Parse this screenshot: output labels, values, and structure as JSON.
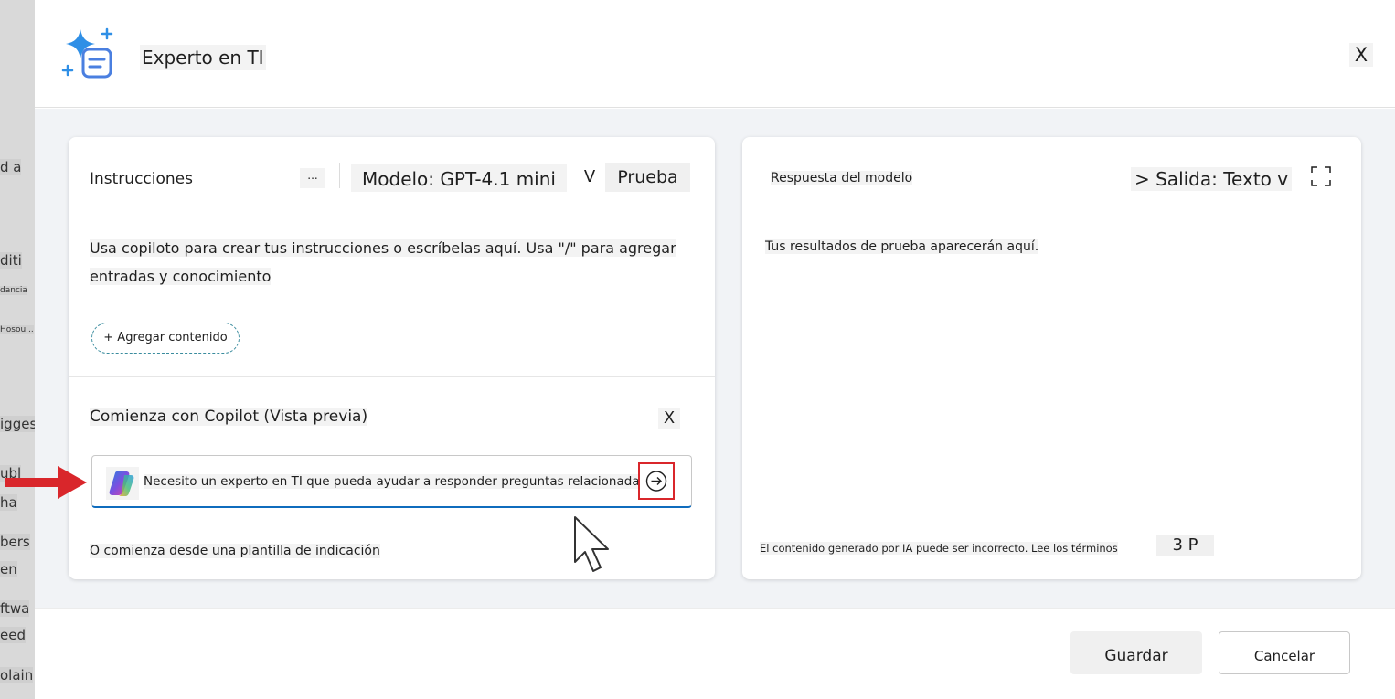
{
  "background": {
    "fragments": [
      "d a",
      "diti",
      "dancia",
      "Hosou...",
      "igges",
      "ubl",
      "ha",
      "bers",
      "en",
      "ftwa",
      "eed",
      "olain"
    ]
  },
  "dialog": {
    "title": "Experto en TI",
    "close_label": "X"
  },
  "instructions_panel": {
    "label": "Instrucciones",
    "more_label": "...",
    "model_label": "Modelo: GPT-4.1 mini",
    "model_chevron": "V",
    "test_button": "Prueba",
    "placeholder_line1": "Usa copiloto para crear tus instrucciones o escríbelas aquí. Usa \"/\" para agregar",
    "placeholder_line2": "entradas y conocimiento",
    "add_content_label": "+ Agregar contenido"
  },
  "copilot": {
    "title": "Comienza con Copilot (Vista previa)",
    "close_label": "X",
    "prompt_value": "Necesito un experto en TI que pueda ayudar a responder preguntas relacionadas",
    "template_link": "O comienza desde una plantilla de indicación"
  },
  "response_panel": {
    "label": "Respuesta del modelo",
    "output_select": "> Salida: Texto v",
    "placeholder": "Tus resultados de prueba aparecerán aquí.",
    "disclaimer": "El contenido generado por IA puede ser incorrecto. Lee los términos",
    "page_badge": "3 P"
  },
  "footer": {
    "save_label": "Guardar",
    "cancel_label": "Cancelar"
  },
  "colors": {
    "accent_blue": "#0f6cbd",
    "highlight_red": "#d9262b",
    "dashed_border": "#3a8c9e"
  }
}
